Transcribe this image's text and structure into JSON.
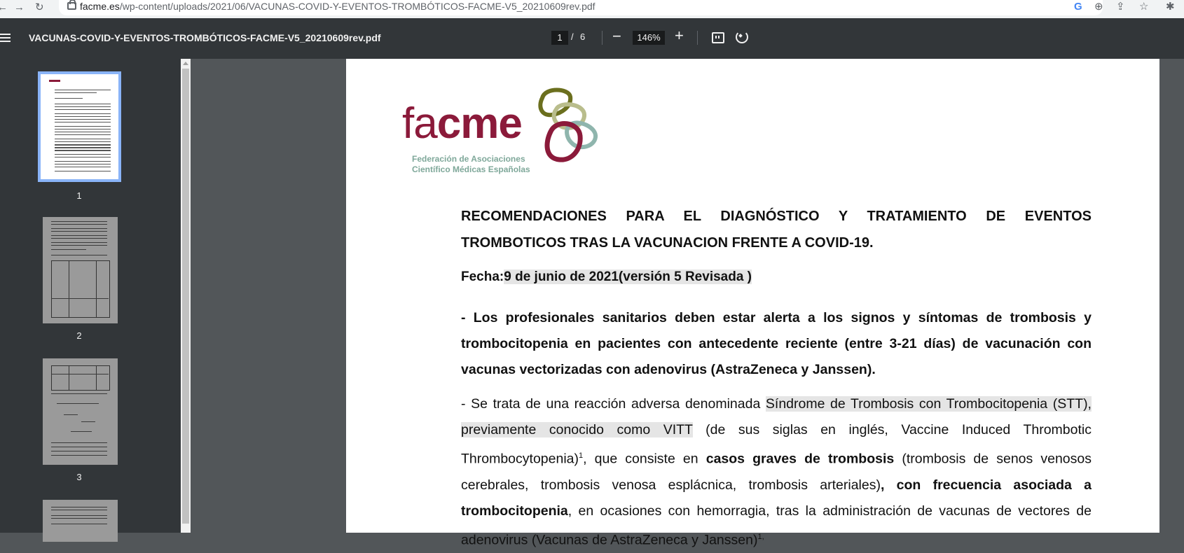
{
  "browser": {
    "url_domain": "facme.es",
    "url_path": "/wp-content/uploads/2021/06/VACUNAS-COVID-Y-EVENTOS-TROMBÓTICOS-FACME-V5_20210609rev.pdf"
  },
  "toolbar": {
    "title": "VACUNAS-COVID-Y-EVENTOS-TROMBÓTICOS-FACME-V5_20210609rev.pdf",
    "current_page": "1",
    "page_separator": "/",
    "total_pages": "6",
    "zoom": "146%"
  },
  "sidebar": {
    "thumbnails": [
      {
        "label": "1",
        "selected": true
      },
      {
        "label": "2",
        "selected": false
      },
      {
        "label": "3",
        "selected": false
      }
    ]
  },
  "document": {
    "logo": {
      "word_light": "fa",
      "word_bold": "cme",
      "sub_line1": "Federación de Asociaciones",
      "sub_line2": "Científico Médicas Españolas",
      "colors": {
        "burgundy": "#8b1a3a",
        "olive": "#6b6f1e",
        "sage": "#b9bd8c",
        "teal": "#8fb5ad"
      }
    },
    "heading": "RECOMENDACIONES PARA EL DIAGNÓSTICO Y TRATAMIENTO DE EVENTOS TROMBOTICOS TRAS LA VACUNACION FRENTE A COVID-19.",
    "fecha_label": "Fecha:",
    "fecha_value": "9 de junio de 2021(versión 5 Revisada )",
    "bullet1": "- Los profesionales sanitarios deben estar alerta a los signos y síntomas de trombosis y trombocitopenia en pacientes con antecedente reciente (entre 3-21 días) de vacunación con vacunas vectorizadas con adenovirus (AstraZeneca y Janssen).",
    "para": {
      "p1": " - Se trata de una reacción adversa denominada ",
      "p2_hl": "Síndrome de Trombosis con Trombocitopenia (STT), previamente conocido como VITT",
      "p3": " (de sus siglas en inglés, Vaccine Induced Thrombotic Thrombocytopenia)",
      "sup1": "1",
      "p4": ", que consiste en ",
      "p5_b": "casos graves de trombosis",
      "p6": " (trombosis de senos venosos cerebrales, trombosis venosa esplácnica, trombosis arteriales)",
      "p7_b": ", con frecuencia asociada a trombocitopenia",
      "p8": ", en ocasiones con hemorragia, tras la administración de vacunas de vectores de adenovirus (Vacunas de AstraZeneca y Janssen)",
      "sup2": "1,"
    }
  }
}
